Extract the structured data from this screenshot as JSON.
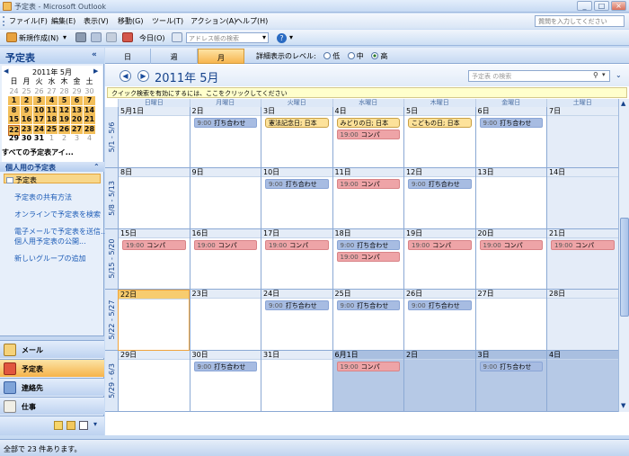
{
  "window": {
    "title": "予定表 - Microsoft Outlook",
    "minimize": "_",
    "maximize": "□",
    "close": "×"
  },
  "menu": [
    "ファイル(F)",
    "編集(E)",
    "表示(V)",
    "移動(G)",
    "ツール(T)",
    "アクション(A)",
    "ヘルプ(H)"
  ],
  "help_placeholder": "質問を入力してください",
  "toolbar": {
    "new_label": "新規作成(N)",
    "today_label": "今日(O)",
    "address_placeholder": "アドレス帳の検索"
  },
  "nav": {
    "title": "予定表",
    "collapse": "«",
    "mini_cal": {
      "title": "2011年 5月",
      "prev": "◀",
      "next": "▶",
      "dow": [
        "日",
        "月",
        "火",
        "水",
        "木",
        "金",
        "土"
      ],
      "weeks": [
        [
          "24",
          "25",
          "26",
          "27",
          "28",
          "29",
          "30"
        ],
        [
          "1",
          "2",
          "3",
          "4",
          "5",
          "6",
          "7"
        ],
        [
          "8",
          "9",
          "10",
          "11",
          "12",
          "13",
          "14"
        ],
        [
          "15",
          "16",
          "17",
          "18",
          "19",
          "20",
          "21"
        ],
        [
          "22",
          "23",
          "24",
          "25",
          "26",
          "27",
          "28"
        ],
        [
          "29",
          "30",
          "31",
          "1",
          "2",
          "3",
          "4"
        ]
      ]
    },
    "all_calendars": "すべての予定表アイ...",
    "my_calendars": "個人用の予定表",
    "calendar_item": "予定表",
    "links": [
      "予定表の共有方法",
      "オンラインで予定表を検索",
      "電子メールで予定表を送信...",
      "個人用予定表の公開...",
      "新しいグループの追加"
    ],
    "buttons": [
      "メール",
      "予定表",
      "連絡先",
      "仕事"
    ]
  },
  "view": {
    "tabs": [
      "日",
      "週",
      "月"
    ],
    "detail_label": "詳細表示のレベル:",
    "detail_options": [
      "低",
      "中",
      "高"
    ],
    "month_title": "2011年 5月",
    "search_placeholder": "予定表 の検索",
    "info_bar": "クイック検索を有効にするには、ここをクリックしてください",
    "dow": [
      "日曜日",
      "月曜日",
      "火曜日",
      "水曜日",
      "木曜日",
      "金曜日",
      "土曜日"
    ]
  },
  "weeks": [
    {
      "label": "5/1 - 5/6",
      "days": [
        {
          "d": "5月1日",
          "ev": []
        },
        {
          "d": "2日",
          "ev": [
            {
              "k": "blue",
              "t": "9:00",
              "s": "打ち合わせ"
            }
          ]
        },
        {
          "d": "3日",
          "ev": [
            {
              "k": "hol",
              "t": "",
              "s": "憲法記念日; 日本"
            }
          ]
        },
        {
          "d": "4日",
          "ev": [
            {
              "k": "hol",
              "t": "",
              "s": "みどりの日; 日本"
            },
            {
              "k": "red",
              "t": "19:00",
              "s": "コンパ"
            }
          ]
        },
        {
          "d": "5日",
          "ev": [
            {
              "k": "hol",
              "t": "",
              "s": "こどもの日; 日本"
            }
          ]
        },
        {
          "d": "6日",
          "ev": [
            {
              "k": "blue",
              "t": "9:00",
              "s": "打ち合わせ"
            }
          ]
        },
        {
          "d": "7日",
          "ev": []
        }
      ]
    },
    {
      "label": "5/8 - 5/13",
      "days": [
        {
          "d": "8日",
          "ev": []
        },
        {
          "d": "9日",
          "ev": []
        },
        {
          "d": "10日",
          "ev": [
            {
              "k": "blue",
              "t": "9:00",
              "s": "打ち合わせ"
            }
          ]
        },
        {
          "d": "11日",
          "ev": [
            {
              "k": "red",
              "t": "19:00",
              "s": "コンパ"
            }
          ]
        },
        {
          "d": "12日",
          "ev": [
            {
              "k": "blue",
              "t": "9:00",
              "s": "打ち合わせ"
            }
          ]
        },
        {
          "d": "13日",
          "ev": []
        },
        {
          "d": "14日",
          "ev": []
        }
      ]
    },
    {
      "label": "5/15 - 5/20",
      "days": [
        {
          "d": "15日",
          "ev": [
            {
              "k": "red",
              "t": "19:00",
              "s": "コンパ"
            }
          ]
        },
        {
          "d": "16日",
          "ev": [
            {
              "k": "red",
              "t": "19:00",
              "s": "コンパ"
            }
          ]
        },
        {
          "d": "17日",
          "ev": [
            {
              "k": "red",
              "t": "19:00",
              "s": "コンパ"
            }
          ]
        },
        {
          "d": "18日",
          "ev": [
            {
              "k": "blue",
              "t": "9:00",
              "s": "打ち合わせ"
            },
            {
              "k": "red",
              "t": "19:00",
              "s": "コンパ"
            }
          ]
        },
        {
          "d": "19日",
          "ev": [
            {
              "k": "red",
              "t": "19:00",
              "s": "コンパ"
            }
          ]
        },
        {
          "d": "20日",
          "ev": [
            {
              "k": "red",
              "t": "19:00",
              "s": "コンパ"
            }
          ]
        },
        {
          "d": "21日",
          "ev": [
            {
              "k": "red",
              "t": "19:00",
              "s": "コンパ"
            }
          ]
        }
      ]
    },
    {
      "label": "5/22 - 5/27",
      "days": [
        {
          "d": "22日",
          "ev": []
        },
        {
          "d": "23日",
          "ev": []
        },
        {
          "d": "24日",
          "ev": [
            {
              "k": "blue",
              "t": "9:00",
              "s": "打ち合わせ"
            }
          ]
        },
        {
          "d": "25日",
          "ev": [
            {
              "k": "blue",
              "t": "9:00",
              "s": "打ち合わせ"
            }
          ]
        },
        {
          "d": "26日",
          "ev": [
            {
              "k": "blue",
              "t": "9:00",
              "s": "打ち合わせ"
            }
          ]
        },
        {
          "d": "27日",
          "ev": []
        },
        {
          "d": "28日",
          "ev": []
        }
      ]
    },
    {
      "label": "5/29 - 6/3",
      "days": [
        {
          "d": "29日",
          "ev": []
        },
        {
          "d": "30日",
          "ev": [
            {
              "k": "blue",
              "t": "9:00",
              "s": "打ち合わせ"
            }
          ]
        },
        {
          "d": "31日",
          "ev": []
        },
        {
          "d": "6月1日",
          "ev": [
            {
              "k": "red",
              "t": "19:00",
              "s": "コンパ"
            }
          ]
        },
        {
          "d": "2日",
          "ev": []
        },
        {
          "d": "3日",
          "ev": [
            {
              "k": "blue",
              "t": "9:00",
              "s": "打ち合わせ"
            }
          ]
        },
        {
          "d": "4日",
          "ev": []
        }
      ]
    }
  ],
  "status": "全部で 23 件あります。",
  "colors": {
    "accent": "#15428b",
    "today": "#f7cc6f",
    "meeting": "#a7bce2",
    "party": "#eea4a7",
    "holiday": "#fde29a"
  }
}
